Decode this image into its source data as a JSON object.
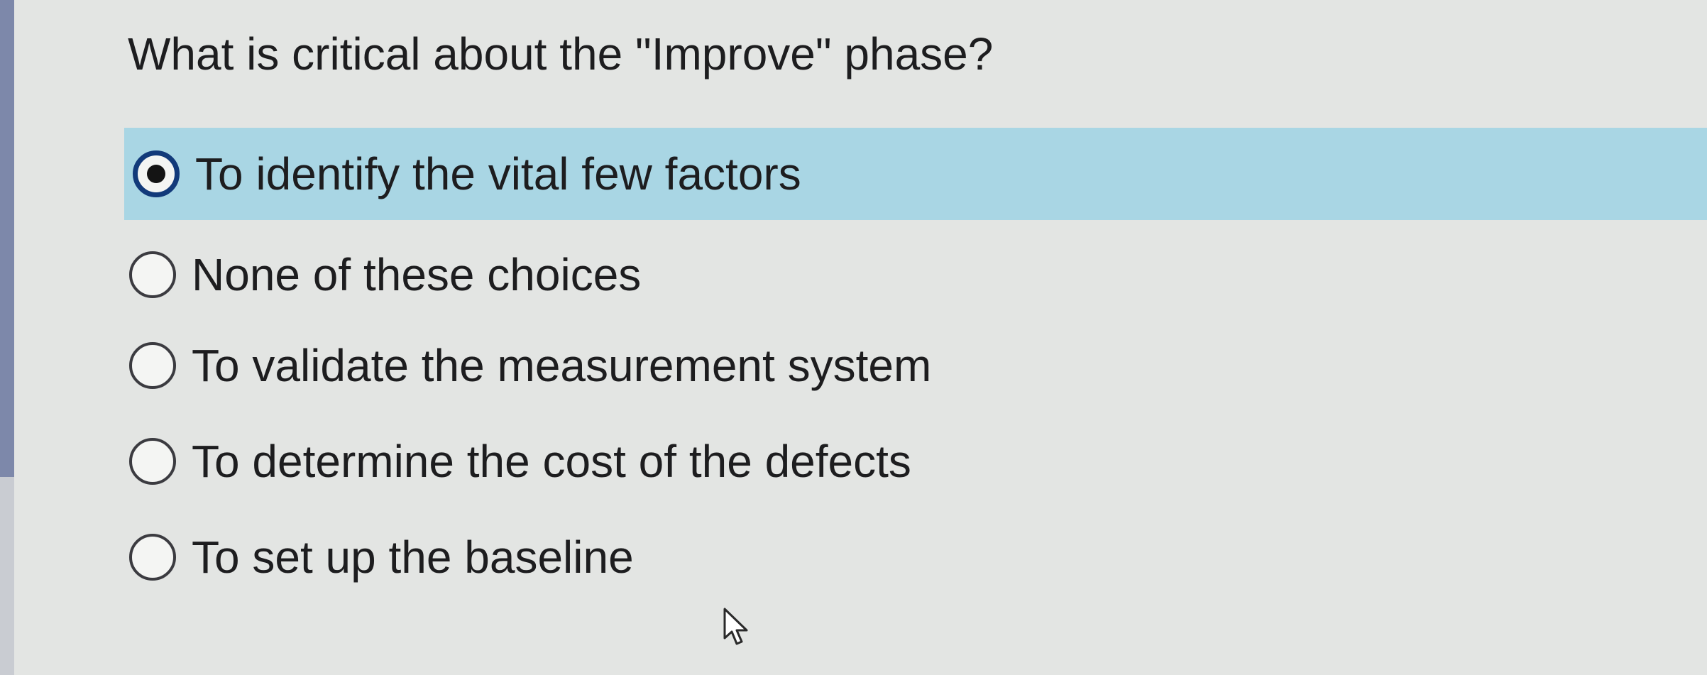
{
  "question": {
    "text": "What is critical about the \"Improve\" phase?"
  },
  "options": [
    {
      "label": "To identify the vital few factors",
      "selected": true
    },
    {
      "label": "None of these choices",
      "selected": false
    },
    {
      "label": "To validate the measurement system",
      "selected": false
    },
    {
      "label": "To determine the cost of the defects",
      "selected": false
    },
    {
      "label": "To set up the baseline",
      "selected": false
    }
  ],
  "colors": {
    "page_background": "#e3e5e3",
    "selected_highlight": "#a9d6e4",
    "selected_radio_ring": "#123a7a",
    "text": "#1d1d1f"
  },
  "icons": {
    "cursor": "mouse-pointer-icon"
  }
}
